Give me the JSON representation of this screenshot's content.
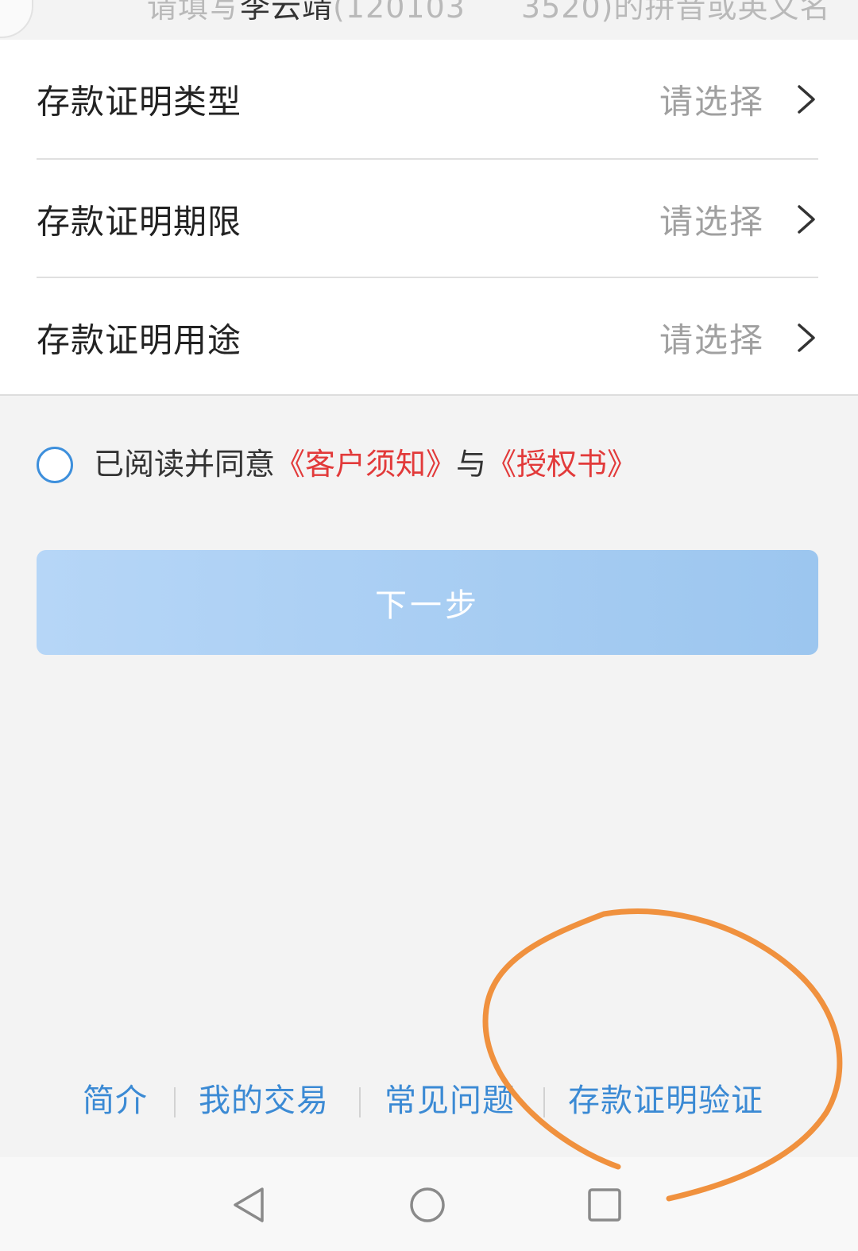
{
  "top_hint": {
    "prefix": "请填写",
    "name": "李云靖",
    "middle": "(120103",
    "suffix": "3520)的拼音或英文名"
  },
  "form": {
    "rows": [
      {
        "label": "存款证明类型",
        "value": "请选择"
      },
      {
        "label": "存款证明期限",
        "value": "请选择"
      },
      {
        "label": "存款证明用途",
        "value": "请选择"
      }
    ]
  },
  "agreement": {
    "prefix": "已阅读并同意",
    "link1": "《客户须知》",
    "joiner": "与",
    "link2": "《授权书》"
  },
  "next_button": {
    "label": "下一步"
  },
  "footer": {
    "links": [
      "简介",
      "我的交易",
      "常见问题",
      "存款证明验证"
    ]
  },
  "colors": {
    "accent_blue": "#3b8ad4",
    "button_blue": "#9cc6ef",
    "link_red": "#e23a3a",
    "annotation_orange": "#f0913e"
  },
  "icons": {
    "chevron": "chevron-right-icon",
    "nav_back": "nav-back-icon",
    "nav_home": "nav-home-icon",
    "nav_recents": "nav-recents-icon"
  }
}
